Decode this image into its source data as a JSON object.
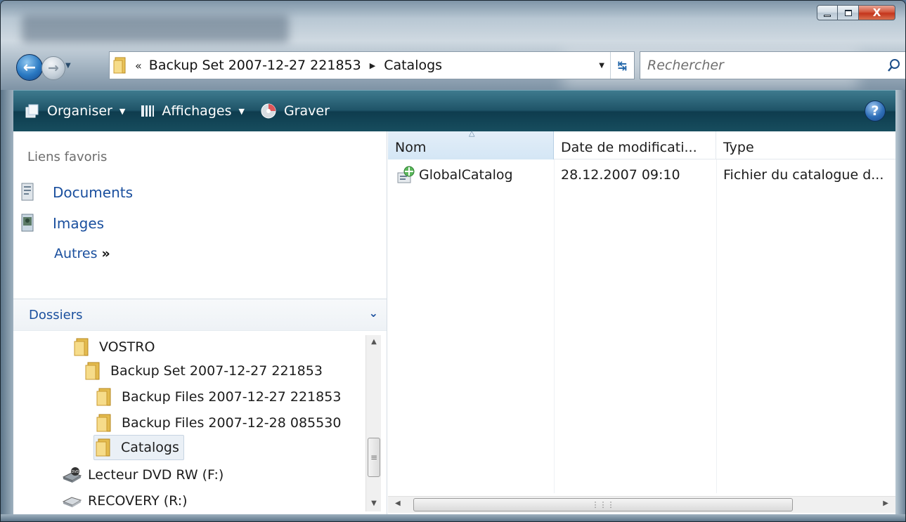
{
  "window": {
    "minimize_label": "",
    "maximize_label": "",
    "close_label": "X"
  },
  "address_bar": {
    "overflow": "«",
    "segments": [
      "Backup Set 2007-12-27 221853",
      "Catalogs"
    ]
  },
  "search": {
    "placeholder": "Rechercher"
  },
  "toolbar": {
    "organiser_label": "Organiser",
    "affichages_label": "Affichages",
    "graver_label": "Graver",
    "help_label": "?"
  },
  "favorites": {
    "title": "Liens favoris",
    "items": [
      {
        "label": "Documents",
        "icon": "documents-icon"
      },
      {
        "label": "Images",
        "icon": "images-icon"
      }
    ],
    "more_label": "Autres",
    "more_glyph": "»"
  },
  "folders": {
    "title": "Dossiers",
    "items": [
      {
        "label": "VOSTRO",
        "icon": "folder-icon"
      },
      {
        "label": "Backup Set 2007-12-27 221853",
        "icon": "folder-icon"
      },
      {
        "label": "Backup Files 2007-12-27 221853",
        "icon": "folder-icon"
      },
      {
        "label": "Backup Files 2007-12-28 085530",
        "icon": "folder-icon"
      },
      {
        "label": "Catalogs",
        "icon": "folder-icon",
        "selected": true
      },
      {
        "label": "Lecteur DVD RW (F:)",
        "icon": "dvd-drive-icon"
      },
      {
        "label": "RECOVERY (R:)",
        "icon": "drive-icon"
      }
    ]
  },
  "file_list": {
    "columns": [
      "Nom",
      "Date de modificati...",
      "Type"
    ],
    "rows": [
      {
        "name": "GlobalCatalog",
        "date": "28.12.2007 09:10",
        "type": "Fichier du catalogue d..."
      }
    ]
  },
  "colors": {
    "toolbar": "#1f5468",
    "link": "#1a4f9e",
    "selection": "#eaf0f6"
  }
}
